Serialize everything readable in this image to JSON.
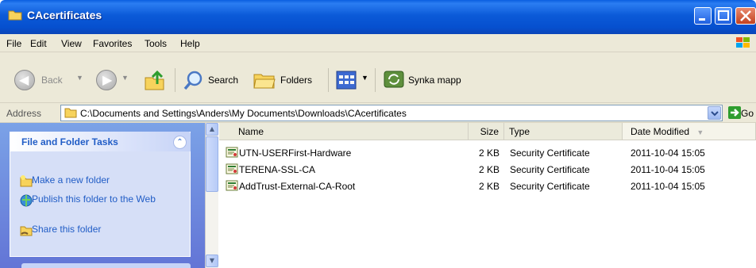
{
  "window": {
    "title": "CAcertificates"
  },
  "menu": [
    "File",
    "Edit",
    "View",
    "Favorites",
    "Tools",
    "Help"
  ],
  "toolbar": {
    "back_label": "Back",
    "search_label": "Search",
    "folders_label": "Folders",
    "sync_label": "Synka mapp"
  },
  "address": {
    "label": "Address",
    "path": "C:\\Documents and Settings\\Anders\\My Documents\\Downloads\\CAcertificates",
    "go_label": "Go"
  },
  "tasks": {
    "header": "File and Folder Tasks",
    "items": [
      "Make a new folder",
      "Publish this folder to the Web",
      "Share this folder"
    ]
  },
  "columns": [
    "Name",
    "Size",
    "Type",
    "Date Modified"
  ],
  "files": [
    {
      "name": "UTN-USERFirst-Hardware",
      "size": "2 KB",
      "type": "Security Certificate",
      "modified": "2011-10-04 15:05"
    },
    {
      "name": "TERENA-SSL-CA",
      "size": "2 KB",
      "type": "Security Certificate",
      "modified": "2011-10-04 15:05"
    },
    {
      "name": "AddTrust-External-CA-Root",
      "size": "2 KB",
      "type": "Security Certificate",
      "modified": "2011-10-04 15:05"
    }
  ],
  "colors": {
    "title_blue": "#0a5fe0",
    "task_link": "#215dc6",
    "chrome": "#ece9d8"
  }
}
